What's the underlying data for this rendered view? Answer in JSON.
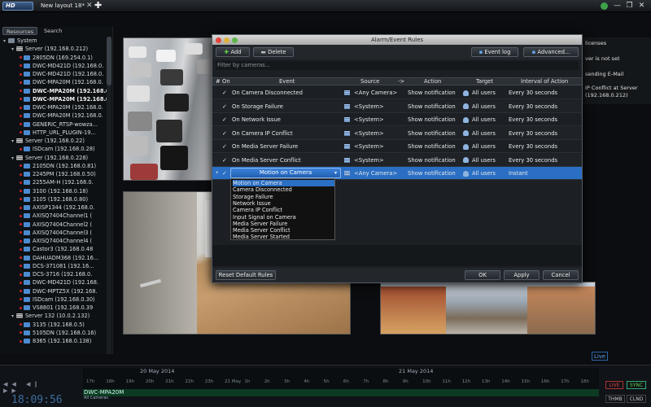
{
  "window": {
    "logo_text": "HD",
    "tab_title": "New layout 18*",
    "tab_close": "✕",
    "tab_add": "✚",
    "controls": [
      "?",
      "—",
      "❐",
      "✕"
    ]
  },
  "left_panel": {
    "tabs": [
      "Resources",
      "Search"
    ],
    "tree": [
      {
        "label": "System",
        "icon": "system-icon",
        "level": 0
      },
      {
        "label": "Server (192.168.0.212)",
        "icon": "server-icon",
        "level": 1
      },
      {
        "label": "2805DN (169.254.0.1)",
        "icon": "camera-icon",
        "level": 2
      },
      {
        "label": "DWC-MD421D (192.168.0.",
        "icon": "camera-icon",
        "level": 2
      },
      {
        "label": "DWC-MD421D (192.168.0.",
        "icon": "camera-icon",
        "level": 2
      },
      {
        "label": "DWC-MPA20M (192.168.0.",
        "icon": "camera-icon",
        "level": 2
      },
      {
        "label": "DWC-MPA20M (192.168.0.",
        "icon": "camera-icon",
        "level": 2,
        "bold": true
      },
      {
        "label": "DWC-MPA20M (192.168.0.",
        "icon": "camera-icon",
        "level": 2,
        "bold": true
      },
      {
        "label": "DWC-MPA20M (192.168.0.",
        "icon": "camera-icon",
        "level": 2
      },
      {
        "label": "DWC-MPA20M (192.168.0.",
        "icon": "camera-icon",
        "level": 2
      },
      {
        "label": "GENERIC_RTSP-wowza...",
        "icon": "camera-icon",
        "level": 2
      },
      {
        "label": "HTTP_URL_PLUGIN-19...",
        "icon": "camera-icon",
        "level": 2
      },
      {
        "label": "Server (192.168.0.22)",
        "icon": "server-icon",
        "level": 1
      },
      {
        "label": "ISDcam (192.168.0.28)",
        "icon": "camera-icon",
        "level": 2
      },
      {
        "label": "Server (192.168.0.228)",
        "icon": "server-icon",
        "level": 1
      },
      {
        "label": "2105DN (192.168.0.81)",
        "icon": "camera-icon",
        "level": 2
      },
      {
        "label": "2245PM (192.168.0.50)",
        "icon": "camera-icon",
        "level": 2
      },
      {
        "label": "2255AM-H (192.168.0.",
        "icon": "camera-icon",
        "level": 2
      },
      {
        "label": "3100 (192.168.0.18)",
        "icon": "camera-icon",
        "level": 2
      },
      {
        "label": "3105 (192.168.0.80)",
        "icon": "camera-icon",
        "level": 2
      },
      {
        "label": "AXISP1344 (192.168.0.",
        "icon": "camera-icon",
        "level": 2
      },
      {
        "label": "AXISQ7404Channel1 (",
        "icon": "camera-icon",
        "level": 2
      },
      {
        "label": "AXISQ7404Channel2 (",
        "icon": "camera-icon",
        "level": 2
      },
      {
        "label": "AXISQ7404Channel3 (",
        "icon": "camera-icon",
        "level": 2
      },
      {
        "label": "AXISQ7404Channel4 (",
        "icon": "camera-icon",
        "level": 2
      },
      {
        "label": "Castor3 (192.168.0.48",
        "icon": "camera-icon",
        "level": 2
      },
      {
        "label": "DAHUADM368 (192.16...",
        "icon": "camera-icon",
        "level": 2
      },
      {
        "label": "DCS-371081 (192.16...",
        "icon": "camera-icon",
        "level": 2
      },
      {
        "label": "DCS-3716 (192.168.0.",
        "icon": "camera-icon",
        "level": 2
      },
      {
        "label": "DWC-MD421D (192.168.",
        "icon": "camera-icon",
        "level": 2
      },
      {
        "label": "DWC-MPTZ5X (192.168.",
        "icon": "camera-icon",
        "level": 2
      },
      {
        "label": "ISDcam (192.168.0.30)",
        "icon": "camera-icon",
        "level": 2
      },
      {
        "label": "VS8801 (192.168.0.39",
        "icon": "camera-icon",
        "level": 2
      },
      {
        "label": "Server 132 (10.0.2.132)",
        "icon": "server-icon",
        "level": 1
      },
      {
        "label": "3135 (192.168.0.5)",
        "icon": "camera-icon",
        "level": 2
      },
      {
        "label": "5105DN (192.168.0.16)",
        "icon": "camera-icon",
        "level": 2
      },
      {
        "label": "8365 (192.168.0.138)",
        "icon": "camera-icon",
        "level": 2
      }
    ]
  },
  "right_panel": {
    "lines": [
      "licenses",
      "ver is not set",
      "sending E-Mail",
      "IP Conflict at Server",
      "(192.168.0.212)"
    ]
  },
  "dialog": {
    "title": "Alarm/Event Rules",
    "toolbar": {
      "add": "Add",
      "delete": "Delete",
      "event_log": "Event log",
      "advanced": "Advanced..."
    },
    "filter_placeholder": "Filter by cameras...",
    "columns": {
      "num": "#",
      "on": "On",
      "event": "Event",
      "source": "Source",
      "arrow": "->",
      "action": "Action",
      "target": "Target",
      "interval": "Interval of Action"
    },
    "rows": [
      {
        "event": "On Camera Disconnected",
        "source": "<Any Camera>",
        "source_icon": "camera-icon",
        "action": "Show notification",
        "target": "All users",
        "interval": "Every 30 seconds"
      },
      {
        "event": "On Storage Failure",
        "source": "<System>",
        "source_icon": "server-icon",
        "action": "Show notification",
        "target": "All users",
        "interval": "Every 30 seconds"
      },
      {
        "event": "On Network Issue",
        "source": "<System>",
        "source_icon": "server-icon",
        "action": "Show notification",
        "target": "All users",
        "interval": "Every 30 seconds"
      },
      {
        "event": "On Camera IP Conflict",
        "source": "<System>",
        "source_icon": "server-icon",
        "action": "Show notification",
        "target": "All users",
        "interval": "Every 30 seconds"
      },
      {
        "event": "On Media Server Failure",
        "source": "<System>",
        "source_icon": "server-icon",
        "action": "Show notification",
        "target": "All users",
        "interval": "Every 30 seconds"
      },
      {
        "event": "On Media Server Conflict",
        "source": "<System>",
        "source_icon": "server-icon",
        "action": "Show notification",
        "target": "All users",
        "interval": "Every 30 seconds"
      }
    ],
    "selected_row": {
      "num": "*",
      "event": "Motion on Camera",
      "source": "<Any Camera>",
      "action": "Show notification",
      "target": "All users",
      "interval": "Instant"
    },
    "event_options": [
      "Motion on Camera",
      "Camera Disconnected",
      "Storage Failure",
      "Network Issue",
      "Camera IP Conflict",
      "Input Signal on Camera",
      "Media Server Failure",
      "Media Server Conflict",
      "Media Server Started"
    ],
    "footer": {
      "reset": "Reset Default Rules",
      "ok": "OK",
      "apply": "Apply",
      "cancel": "Cancel"
    }
  },
  "timeline": {
    "live_label": "Live",
    "clock": "18:09:56",
    "dates": [
      "20 May 2014",
      "21 May 2014"
    ],
    "hours": [
      "17h",
      "18h",
      "19h",
      "20h",
      "21h",
      "22h",
      "23h",
      "21 May",
      "1h",
      "2h",
      "3h",
      "4h",
      "5h",
      "6h",
      "7h",
      "8h",
      "9h",
      "10h",
      "11h",
      "12h",
      "13h",
      "14h",
      "15h",
      "16h",
      "17h",
      "18h"
    ],
    "camera_label": "DWC-MPA20M",
    "camera_sub": "All Cameras",
    "buttons": {
      "live": "LIVE",
      "sync": "SYNC",
      "thumb": "THMB",
      "calendar": "CLND"
    }
  }
}
